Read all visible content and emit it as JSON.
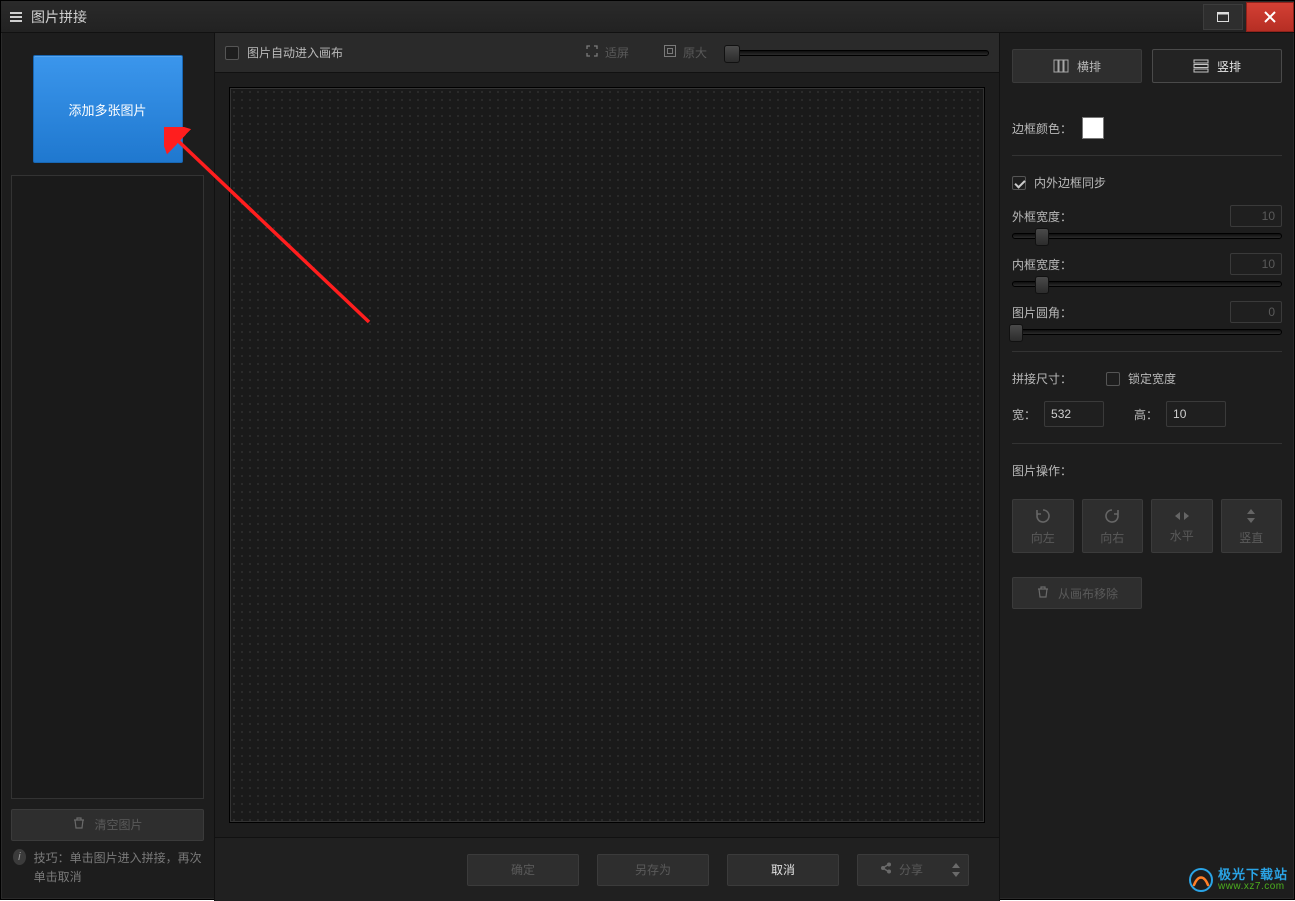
{
  "title": "图片拼接",
  "sidebar": {
    "add_button": "添加多张图片",
    "clear_button": "清空图片",
    "tip_label": "技巧：",
    "tip_text": "单击图片进入拼接，再次单击取消"
  },
  "center": {
    "auto_canvas": "图片自动进入画布",
    "fit": "适屏",
    "actual": "原大",
    "ok": "确定",
    "save_as": "另存为",
    "cancel": "取消",
    "share": "分享"
  },
  "right": {
    "tab_h": "横排",
    "tab_v": "竖排",
    "border_color": "边框颜色：",
    "sync_border": "内外边框同步",
    "outer_label": "外框宽度：",
    "outer_value": "10",
    "inner_label": "内框宽度：",
    "inner_value": "10",
    "radius_label": "图片圆角：",
    "radius_value": "0",
    "size_label": "拼接尺寸：",
    "lock_width": "锁定宽度",
    "width_label": "宽：",
    "width_value": "532",
    "height_label": "高：",
    "height_value": "10",
    "ops_label": "图片操作：",
    "rot_left": "向左",
    "rot_right": "向右",
    "flip_h": "水平",
    "flip_v": "竖直",
    "remove": "从画布移除"
  },
  "watermark": {
    "line1": "极光下载站",
    "line2": "www.xz7.com"
  }
}
